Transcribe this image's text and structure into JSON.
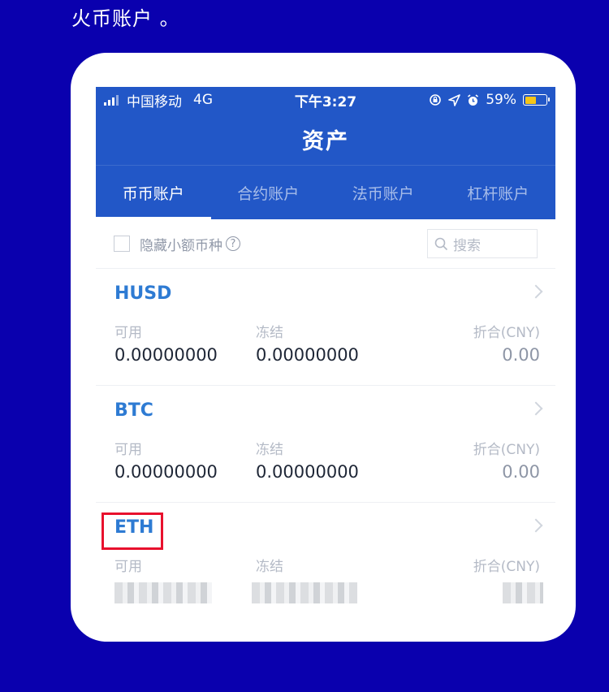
{
  "caption": "火币账户 。",
  "status_bar": {
    "carrier": "中国移动",
    "network": "4G",
    "time": "下午3:27",
    "battery": "59%",
    "battery_level": 0.59
  },
  "title": "资产",
  "tabs": [
    {
      "label": "币币账户",
      "active": true
    },
    {
      "label": "合约账户",
      "active": false
    },
    {
      "label": "法币账户",
      "active": false
    },
    {
      "label": "杠杆账户",
      "active": false
    }
  ],
  "filter": {
    "hide_small_label": "隐藏小额币种",
    "help_glyph": "?",
    "search_placeholder": "搜索"
  },
  "columns": {
    "available": "可用",
    "frozen": "冻结",
    "cny": "折合(CNY)"
  },
  "assets": [
    {
      "coin": "HUSD",
      "available": "0.00000000",
      "frozen": "0.00000000",
      "cny": "0.00"
    },
    {
      "coin": "BTC",
      "available": "0.00000000",
      "frozen": "0.00000000",
      "cny": "0.00"
    },
    {
      "coin": "ETH",
      "available": "",
      "frozen": "",
      "cny": ""
    }
  ],
  "colors": {
    "background": "#0A00AE",
    "header": "#2257C7",
    "coin_text": "#2E7BD3",
    "highlight": "#E8112D",
    "battery_fill": "#F5C518"
  }
}
